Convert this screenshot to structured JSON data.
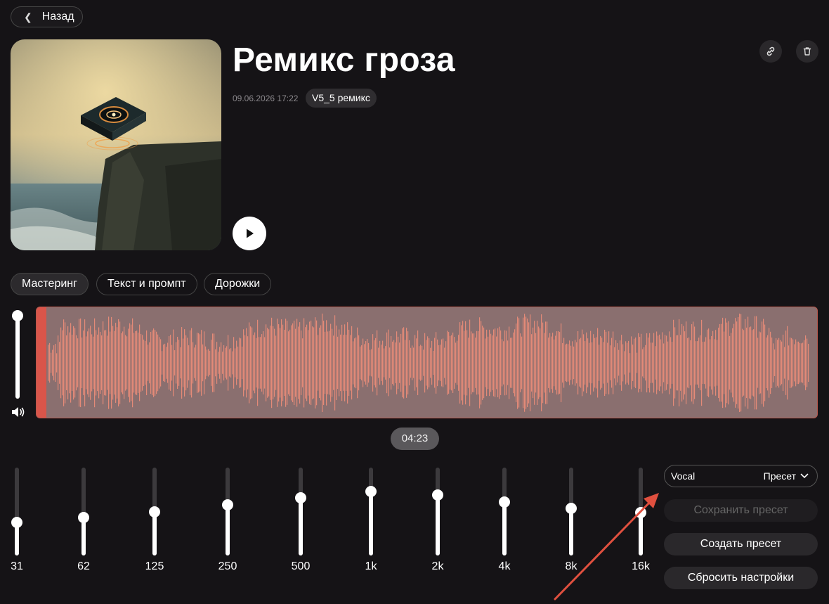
{
  "nav": {
    "back_label": "Назад"
  },
  "track": {
    "title": "Ремикс гроза",
    "date": "09.06.2026 17:22",
    "version_badge": "V5_5 ремикс"
  },
  "tabs": [
    {
      "label": "Мастеринг",
      "active": true
    },
    {
      "label": "Текст и промпт",
      "active": false
    },
    {
      "label": "Дорожки",
      "active": false
    }
  ],
  "player": {
    "duration": "04:23",
    "volume_level": 1.0,
    "progress": 0.01
  },
  "equalizer": {
    "bands": [
      {
        "label": "31",
        "level": 0.38
      },
      {
        "label": "62",
        "level": 0.43
      },
      {
        "label": "125",
        "level": 0.5
      },
      {
        "label": "250",
        "level": 0.58
      },
      {
        "label": "500",
        "level": 0.66
      },
      {
        "label": "1k",
        "level": 0.73
      },
      {
        "label": "2k",
        "level": 0.69
      },
      {
        "label": "4k",
        "level": 0.61
      },
      {
        "label": "8k",
        "level": 0.54
      },
      {
        "label": "16k",
        "level": 0.49
      }
    ]
  },
  "presets": {
    "current": "Vocal",
    "dropdown_label": "Пресет",
    "save_label": "Сохранить пресет",
    "create_label": "Создать пресет",
    "reset_label": "Сбросить настройки"
  },
  "icons": {
    "back": "chevron-left-icon",
    "link": "link-icon",
    "delete": "trash-icon",
    "play": "play-icon",
    "volume": "speaker-icon",
    "dropdown": "chevron-down-icon"
  },
  "colors": {
    "background": "#151316",
    "waveform": "#e48a78",
    "waveform_bg": "#8a6f6f",
    "progress": "#d9554a",
    "annotation_arrow": "#e0503f"
  }
}
